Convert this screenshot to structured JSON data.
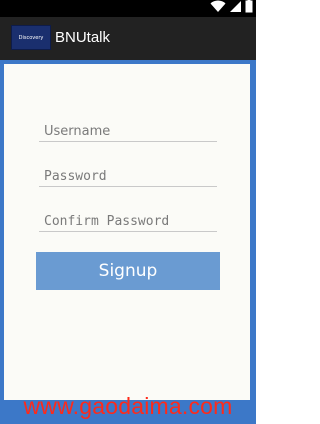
{
  "status_bar": {
    "icons": [
      "wifi-icon",
      "cell-signal-icon",
      "battery-icon"
    ]
  },
  "app_bar": {
    "logo_text": "Discovery",
    "title": "BNUtalk"
  },
  "form": {
    "username_placeholder": "Username",
    "password_placeholder": "Password",
    "confirm_password_placeholder": "Confirm Password",
    "signup_label": "Signup"
  },
  "watermark": {
    "text": "www.gaodaima.com"
  },
  "colors": {
    "frame": "#3c78c8",
    "button": "#6a9bd2",
    "app_bar": "#222222",
    "watermark": "#ff2a1a"
  }
}
